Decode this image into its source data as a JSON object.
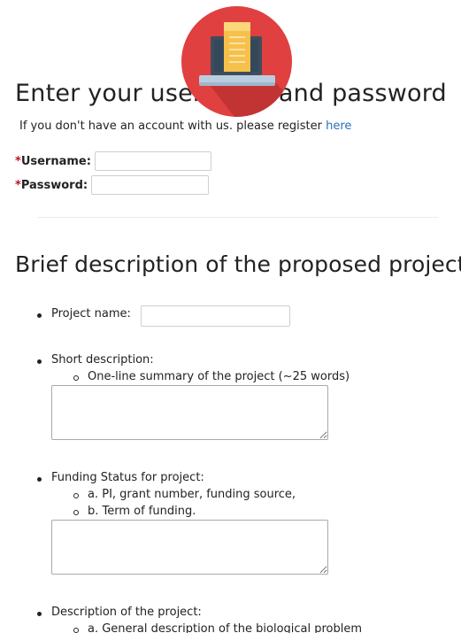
{
  "login": {
    "title": "Enter your username and password",
    "register_prefix": "If you don't have an account with us. please register ",
    "register_link": "here",
    "username_marker": "*",
    "username_label": "Username:",
    "password_marker": "*",
    "password_label": "Password:",
    "username_value": "",
    "password_value": ""
  },
  "project": {
    "title": "Brief description of the proposed project",
    "name_label": "Project name:",
    "name_value": "",
    "short_desc_label": "Short description:",
    "short_desc_sub": "One-line summary of the project (~25 words)",
    "funding_label": "Funding Status for project:",
    "funding_sub_a": "a. PI, grant number, funding source,",
    "funding_sub_b": "b. Term of funding.",
    "description_label": "Description of the project:",
    "description_sub_a": "a. General description of the biological problem"
  },
  "colors": {
    "logo_background": "#e0403f",
    "link": "#2a6fb8",
    "required_marker": "#c0141c"
  },
  "icons": {
    "app_logo": "laptop-document-icon"
  }
}
